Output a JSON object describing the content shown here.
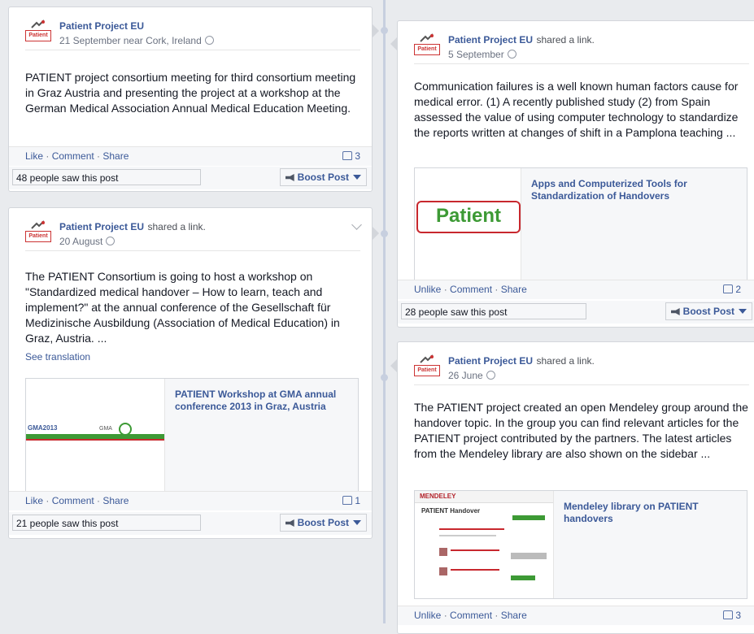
{
  "posts": [
    {
      "page_name": "Patient Project EU",
      "shared_text": "",
      "meta": "21 September near Cork, Ireland",
      "body": "PATIENT project consortium meeting for third consortium meeting in Graz Austria and presenting the project at a workshop at the German Medical Association Annual Medical Education Meeting.",
      "actions": [
        "Like",
        "Comment",
        "Share"
      ],
      "likes": "3",
      "seen": "48 people saw this post",
      "boost": "Boost Post"
    },
    {
      "page_name": "Patient Project EU",
      "shared_text": "shared a link.",
      "meta": "20 August",
      "body": "The PATIENT Consortium is going to host a workshop on \"Standardized medical handover – How to learn, teach and implement?\" at the annual conference of the Gesellschaft für Medizinische Ausbildung (Association of Medical Education) in Graz, Austria. ...",
      "see_translation": "See translation",
      "link_title": "PATIENT Workshop at GMA annual conference 2013 in Graz, Austria",
      "thumb_text": "GMA2013",
      "thumb_subtext": "GMA",
      "actions": [
        "Like",
        "Comment",
        "Share"
      ],
      "likes": "1",
      "seen": "21 people saw this post",
      "boost": "Boost Post"
    },
    {
      "page_name": "Patient Project EU",
      "shared_text": "shared a link.",
      "meta": "5 September",
      "body": "Communication failures is a well known human factors cause for medical error. (1) A recently published study (2) from Spain assessed the value of using computer technology to standardize the reports written at changes of shift in a Pamplona teaching ...",
      "link_title": "Apps and Computerized Tools for Standardization of Handovers",
      "thumb_logo": "Patient",
      "actions": [
        "Unlike",
        "Comment",
        "Share"
      ],
      "likes": "2",
      "seen": "28 people saw this post",
      "boost": "Boost Post"
    },
    {
      "page_name": "Patient Project EU",
      "shared_text": "shared a link.",
      "meta": "26 June",
      "body": "The PATIENT project created an open Mendeley group around the handover topic. In the group you can find relevant articles for the PATIENT project contributed by the partners. The latest articles from the Mendeley library are also shown on the sidebar ...",
      "link_title": "Mendeley library on PATIENT handovers",
      "thumb_brand": "MENDELEY",
      "thumb_heading": "PATIENT Handover",
      "actions": [
        "Unlike",
        "Comment",
        "Share"
      ],
      "likes": "3"
    }
  ],
  "avatar_label": "Patient",
  "colors": {
    "link": "#3b5998",
    "patient_red": "#c8282e",
    "patient_green": "#3d9a35"
  }
}
